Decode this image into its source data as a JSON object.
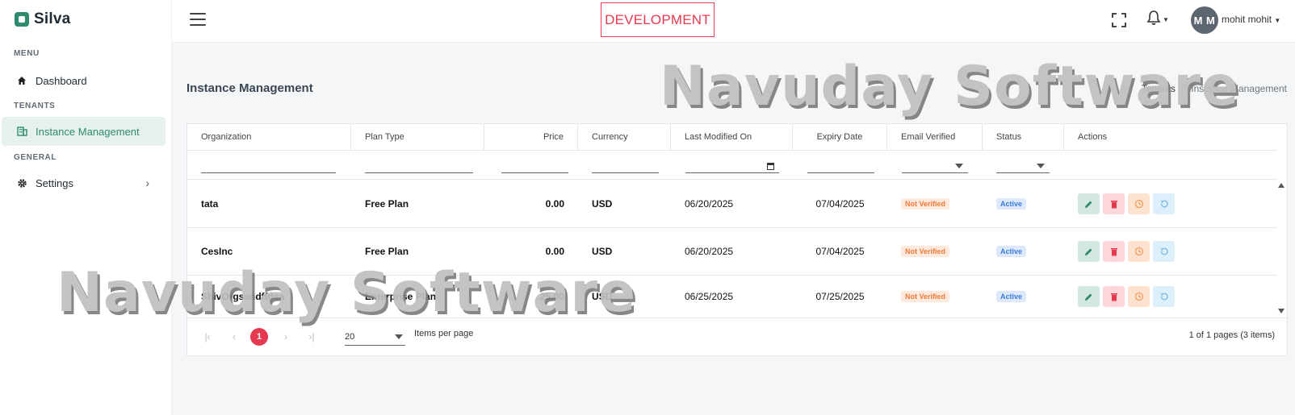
{
  "app": {
    "name": "Silva",
    "environment": "DEVELOPMENT"
  },
  "sidebar": {
    "sections": [
      {
        "heading": "MENU",
        "items": [
          {
            "label": "Dashboard",
            "icon": "home-icon"
          }
        ]
      },
      {
        "heading": "TENANTS",
        "items": [
          {
            "label": "Instance Management",
            "icon": "building-icon",
            "active": true
          }
        ]
      },
      {
        "heading": "GENERAL",
        "items": [
          {
            "label": "Settings",
            "icon": "gear-icon",
            "has_children": true
          }
        ]
      }
    ]
  },
  "topbar": {
    "user": {
      "initials": "M M",
      "name": "mohit mohit"
    }
  },
  "page": {
    "title": "Instance Management",
    "breadcrumb": [
      "Tenants",
      "Instance Management"
    ]
  },
  "watermark": "Navuday Software",
  "grid": {
    "columns": [
      "Organization",
      "Plan Type",
      "Price",
      "Currency",
      "Last Modified On",
      "Expiry Date",
      "Email Verified",
      "Status",
      "Actions"
    ],
    "rows": [
      {
        "organization": "tata",
        "plan": "Free Plan",
        "price": "0.00",
        "currency": "USD",
        "modified": "06/20/2025",
        "expiry": "07/04/2025",
        "email": "Not Verified",
        "status": "Active"
      },
      {
        "organization": "CesInc",
        "plan": "Free Plan",
        "price": "0.00",
        "currency": "USD",
        "modified": "06/20/2025",
        "expiry": "07/04/2025",
        "email": "Not Verified",
        "status": "Active"
      },
      {
        "organization": "ShivOrgsandffdsa",
        "plan": "Enterprise Plan",
        "price": "25.00",
        "currency": "USD",
        "modified": "06/25/2025",
        "expiry": "07/25/2025",
        "email": "Not Verified",
        "status": "Active"
      }
    ]
  },
  "pager": {
    "current_page": "1",
    "page_size": "20",
    "items_per_page_label": "Items per page",
    "info": "1 of 1 pages (3 items)"
  },
  "colors": {
    "accent": "#2e8b6f",
    "danger": "#e53950"
  }
}
